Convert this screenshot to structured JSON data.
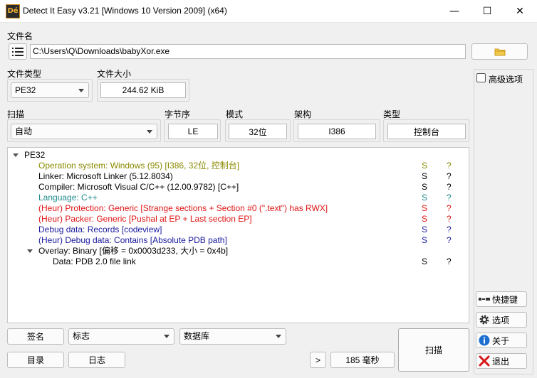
{
  "window": {
    "title": "Detect It Easy v3.21 [Windows 10 Version 2009] (x64)",
    "icon_text": "Dé",
    "minimize_glyph": "—",
    "maximize_glyph": "☐",
    "close_glyph": "✕"
  },
  "file": {
    "label": "文件名",
    "path": "C:\\Users\\Q\\Downloads\\babyXor.exe"
  },
  "file_type": {
    "label": "文件类型",
    "value": "PE32"
  },
  "file_size": {
    "label": "文件大小",
    "value": "244.62 KiB"
  },
  "scan": {
    "label": "扫描",
    "value": "自动"
  },
  "endianness": {
    "label": "字节序",
    "value": "LE"
  },
  "mode": {
    "label": "模式",
    "value": "32位"
  },
  "arch": {
    "label": "架构",
    "value": "I386"
  },
  "type": {
    "label": "类型",
    "value": "控制台"
  },
  "advanced": {
    "label": "高级选项",
    "checked": false
  },
  "results": [
    {
      "text": "PE32",
      "indent": 1,
      "toggle": true,
      "color": "#000000",
      "s": "",
      "q": ""
    },
    {
      "text": "Operation system: Windows (95) [I386, 32位, 控制台]",
      "indent": 2,
      "toggle": false,
      "color": "#8a8a00",
      "s": "S",
      "q": "?"
    },
    {
      "text": "Linker: Microsoft Linker (5.12.8034)",
      "indent": 2,
      "toggle": false,
      "color": "#000000",
      "s": "S",
      "q": "?"
    },
    {
      "text": "Compiler: Microsoft Visual C/C++ (12.00.9782) [C++]",
      "indent": 2,
      "toggle": false,
      "color": "#000000",
      "s": "S",
      "q": "?"
    },
    {
      "text": "Language: C++",
      "indent": 2,
      "toggle": false,
      "color": "#1f8a8a",
      "s": "S",
      "q": "?"
    },
    {
      "text": "(Heur) Protection: Generic [Strange sections + Section #0 (\".text\") has RWX]",
      "indent": 2,
      "toggle": false,
      "color": "#e01414",
      "s": "S",
      "q": "?"
    },
    {
      "text": "(Heur) Packer: Generic [Pushal at EP + Last section EP]",
      "indent": 2,
      "toggle": false,
      "color": "#e01414",
      "s": "S",
      "q": "?"
    },
    {
      "text": "Debug data: Records [codeview]",
      "indent": 2,
      "toggle": false,
      "color": "#1a1a9e",
      "s": "S",
      "q": "?"
    },
    {
      "text": "(Heur) Debug data: Contains [Absolute PDB path]",
      "indent": 2,
      "toggle": false,
      "color": "#1a1a9e",
      "s": "S",
      "q": "?"
    },
    {
      "text": "Overlay: Binary [偏移 = 0x0003d233, 大小 = 0x4b]",
      "indent": 2,
      "toggle": true,
      "color": "#000000",
      "s": "",
      "q": ""
    },
    {
      "text": "Data: PDB 2.0 file link",
      "indent": 3,
      "toggle": false,
      "color": "#000000",
      "s": "S",
      "q": "?"
    }
  ],
  "bottom": {
    "signature": "签名",
    "flags": "标志",
    "database": "数据库",
    "directory": "目录",
    "log": "日志",
    "more": ">",
    "elapsed": "185 毫秒",
    "scan": "扫描"
  },
  "side": {
    "shortcuts": "快捷键",
    "options": "选项",
    "about": "关于",
    "exit": "退出"
  }
}
